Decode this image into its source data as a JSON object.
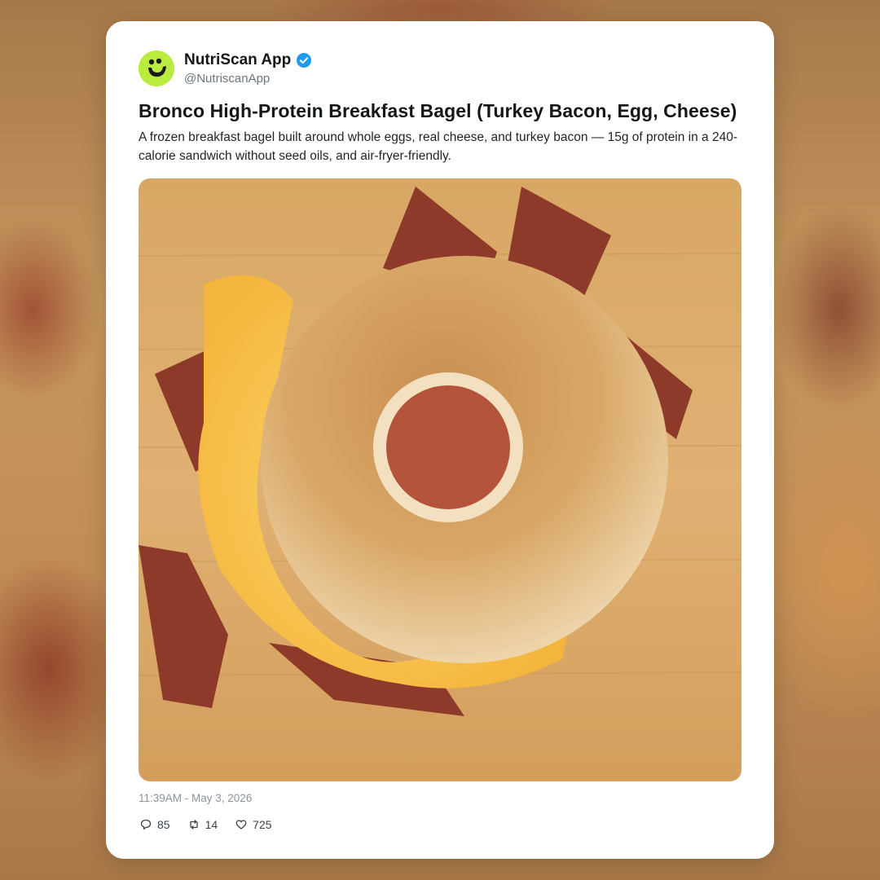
{
  "account": {
    "name": "NutriScan App",
    "handle": "@NutriscanApp",
    "verified": true,
    "avatar_icon": "smiley-face-icon",
    "avatar_color": "#b9ec3f",
    "verified_color": "#1d9bf0"
  },
  "post": {
    "title": "Bronco High-Protein Breakfast Bagel (Turkey Bacon, Egg, Cheese)",
    "description": "A frozen breakfast bagel built around whole eggs, real cheese, and turkey bacon — 15g of protein in a 240-calorie sandwich without seed oils, and air-fryer-friendly.",
    "image_icon": "breakfast-bagel-photo",
    "timestamp": "11:39AM - May 3, 2026"
  },
  "actions": {
    "replies": "85",
    "reposts": "14",
    "likes": "725",
    "reply_icon": "comment-icon",
    "repost_icon": "repost-icon",
    "like_icon": "heart-icon"
  }
}
